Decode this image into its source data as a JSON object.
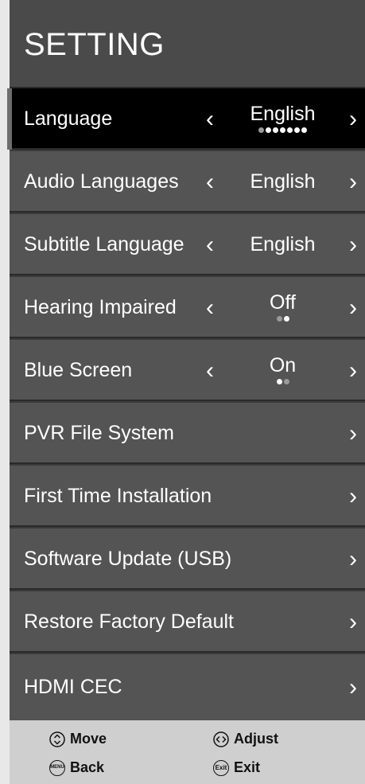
{
  "header": {
    "title": "SETTING"
  },
  "rows": [
    {
      "label": "Language",
      "value": "English"
    },
    {
      "label": "Audio Languages",
      "value": "English"
    },
    {
      "label": "Subtitle Language",
      "value": "English"
    },
    {
      "label": "Hearing Impaired",
      "value": "Off"
    },
    {
      "label": "Blue Screen",
      "value": "On"
    },
    {
      "label": "PVR File System"
    },
    {
      "label": "First Time Installation"
    },
    {
      "label": "Software Update (USB)"
    },
    {
      "label": "Restore Factory Default"
    },
    {
      "label": "HDMI CEC"
    }
  ],
  "icons": {
    "left": "chevron-left-icon",
    "right": "chevron-right-icon",
    "move": "up-down-icon",
    "adjust": "left-right-icon",
    "back": "menu-icon",
    "exit": "exit-icon"
  },
  "arrows": {
    "left": "‹",
    "right": "›"
  },
  "footer": {
    "move": "Move",
    "adjust": "Adjust",
    "back": "Back",
    "exit": "Exit",
    "menu_icon_text": "MENU",
    "exit_icon_text": "Exit"
  }
}
